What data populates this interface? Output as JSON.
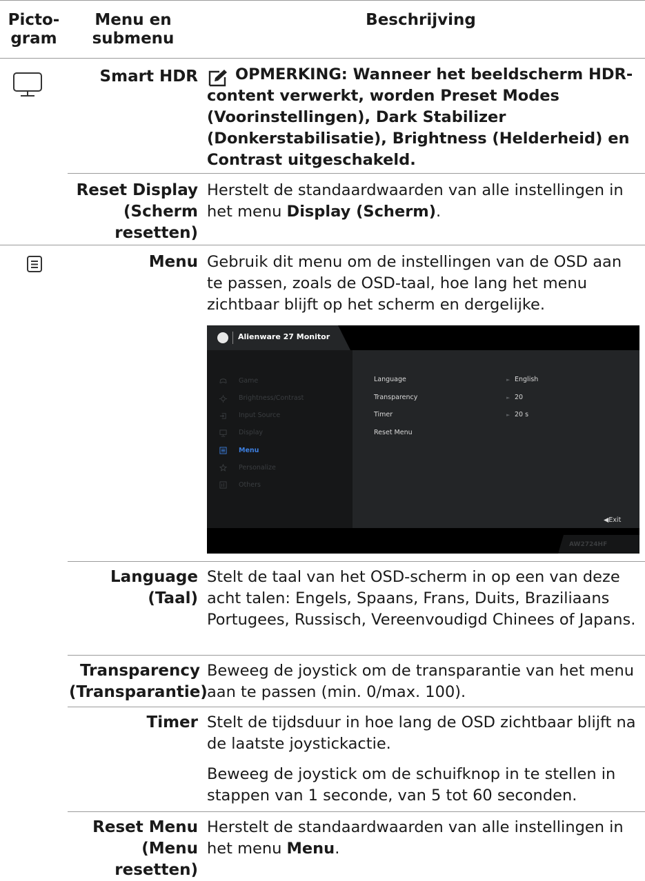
{
  "header": {
    "col1": "Picto-\ngram",
    "col2": "Menu en\nsubmenu",
    "col3": "Beschrijving"
  },
  "rows": {
    "smart_hdr": {
      "label": "Smart HDR",
      "note": "OPMERKING: Wanneer het beeldscherm HDR-content verwerkt, worden Preset Modes (Voorinstellingen), Dark Stabilizer (Donkerstabilisatie), Brightness (Helderheid) en Contrast uitgeschakeld."
    },
    "reset_display": {
      "label": "Reset Display\n(Scherm\nresetten)",
      "desc_pre": "Herstelt de standaardwaarden van alle instellingen in het menu ",
      "desc_bold": "Display (Scherm)",
      "desc_post": "."
    },
    "menu": {
      "label": "Menu",
      "desc": "Gebruik dit menu om de instellingen van de OSD aan te passen, zoals de OSD-taal, hoe lang het menu zichtbaar blijft op het scherm en dergelijke."
    },
    "language": {
      "label": "Language\n(Taal)",
      "desc": "Stelt de taal van het OSD-scherm in op een van deze acht talen: Engels, Spaans, Frans, Duits, Braziliaans Portugees, Russisch, Vereenvoudigd Chinees of Japans."
    },
    "transparency": {
      "label": "Transparency\n(Transparantie)",
      "desc": "Beweeg de joystick om de transparantie van het menu aan te passen (min. 0/max. 100)."
    },
    "timer": {
      "label": "Timer",
      "desc1": "Stelt de tijdsduur in hoe lang de OSD zichtbaar blijft na de laatste joystickactie.",
      "desc2": "Beweeg de joystick om de schuifknop in te stellen in stappen van 1 seconde, van 5 tot 60 seconden."
    },
    "reset_menu": {
      "label": "Reset Menu\n(Menu\nresetten)",
      "desc_pre": "Herstelt de standaardwaarden van alle instellingen in het menu ",
      "desc_bold": "Menu",
      "desc_post": "."
    }
  },
  "osd": {
    "title": "Alienware 27 Monitor",
    "nav": [
      "Game",
      "Brightness/Contrast",
      "Input Source",
      "Display",
      "Menu",
      "Personalize",
      "Others"
    ],
    "active_nav": "Menu",
    "settings": [
      {
        "name": "Language",
        "value": "English"
      },
      {
        "name": "Transparency",
        "value": "20"
      },
      {
        "name": "Timer",
        "value": "20 s"
      },
      {
        "name": "Reset Menu",
        "value": ""
      }
    ],
    "exit": "Exit",
    "model": "AW2724HF",
    "accent_color": "#3d7fe0"
  },
  "icons": [
    "monitor-icon",
    "menu-list-icon",
    "pencil-note-icon"
  ]
}
